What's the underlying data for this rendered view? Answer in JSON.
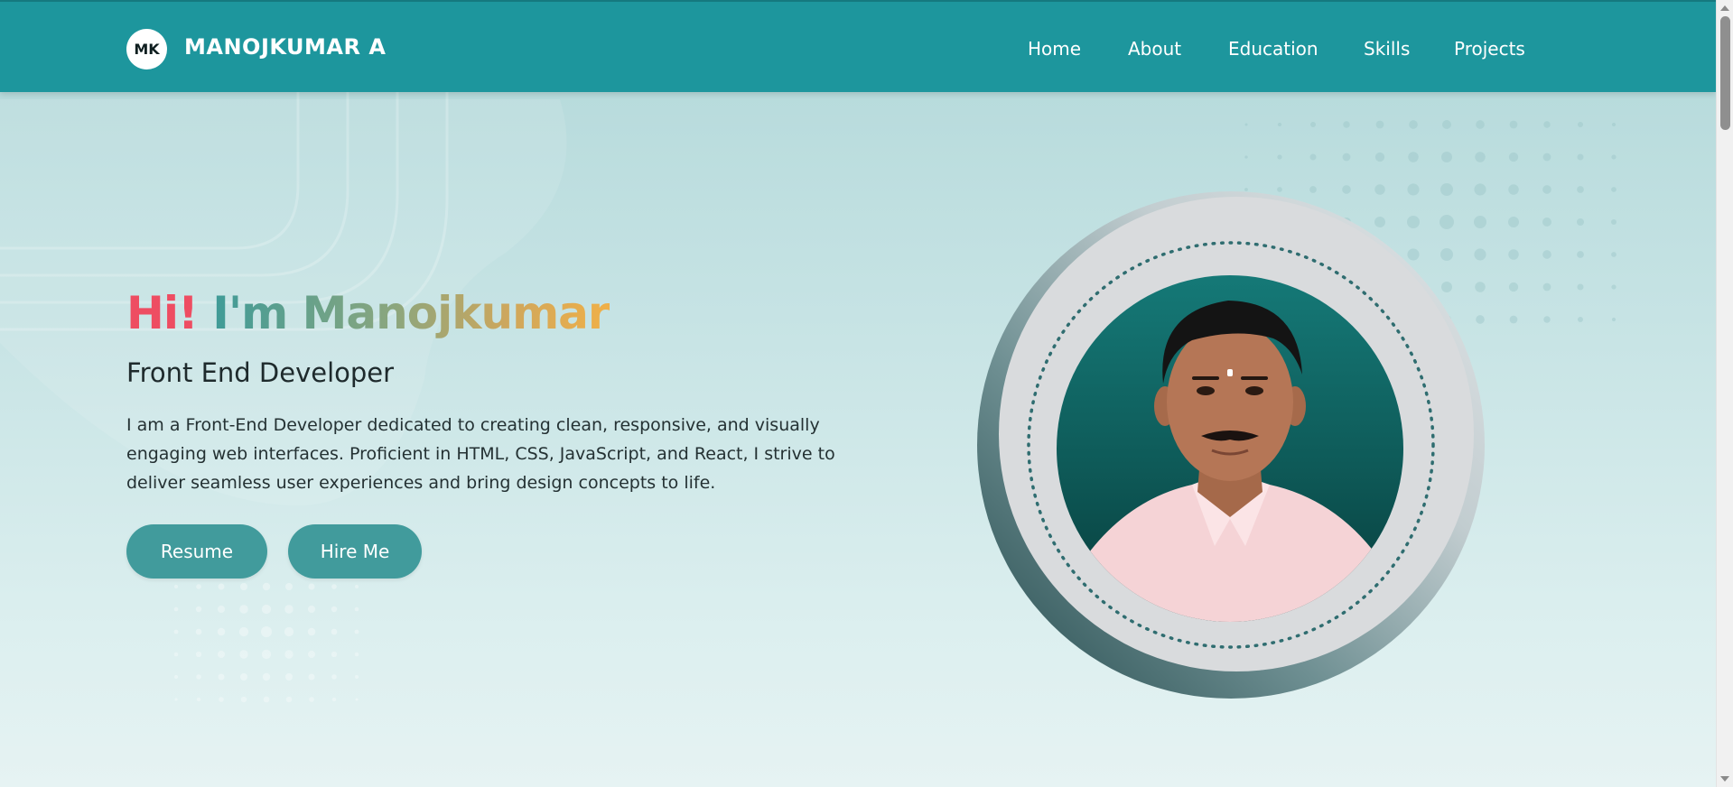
{
  "navbar": {
    "logo_initials": "MK",
    "brand": "MANOJKUMAR A",
    "links": [
      "Home",
      "About",
      "Education",
      "Skills",
      "Projects"
    ]
  },
  "hero": {
    "greeting": "Hi!",
    "intro": "I'm Manojkumar",
    "role": "Front End Developer",
    "bio": "I am a Front-End Developer dedicated to creating clean, responsive, and visually engaging web interfaces. Proficient in HTML, CSS, JavaScript, and React, I strive to deliver seamless user experiences and bring design concepts to life.",
    "buttons": [
      "Resume",
      "Hire Me"
    ]
  },
  "colors": {
    "navbar_bg": "#1d969d",
    "greeting": "#ee4d62",
    "button_bg": "#419b9c",
    "page_bg": "#c6e3e4"
  }
}
